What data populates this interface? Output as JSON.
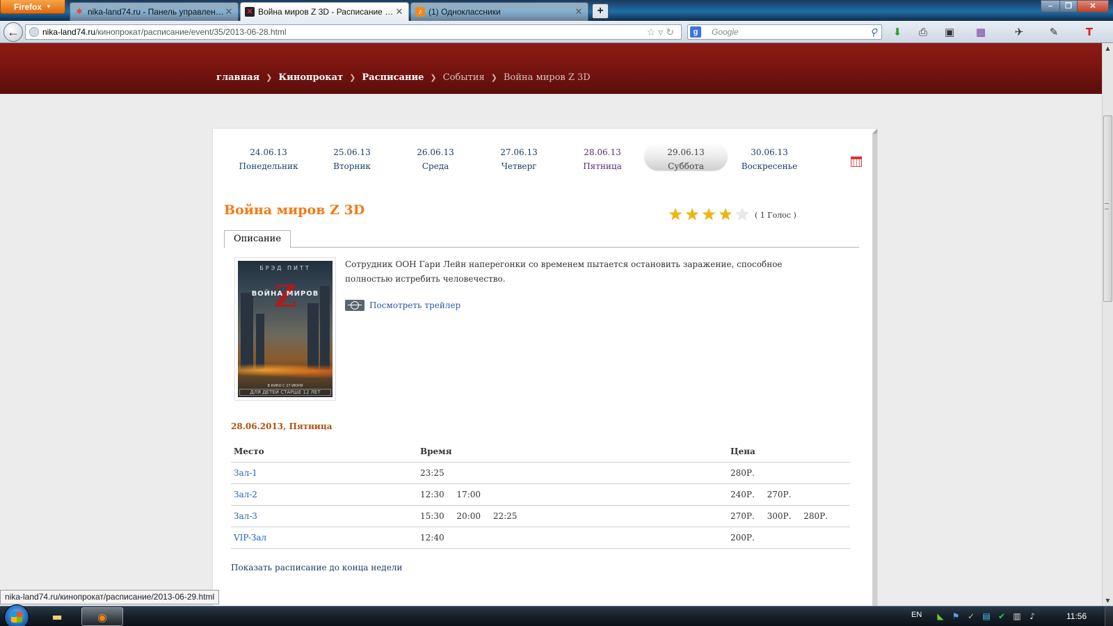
{
  "browser": {
    "app_button": "Firefox",
    "tabs": [
      {
        "label": "nika-land74.ru - Панель управления...",
        "favicon": "joomla-icon"
      },
      {
        "label": "Война миров Z 3D - Расписание - ni...",
        "favicon": "site-icon"
      },
      {
        "label": "(1) Одноклассники",
        "favicon": "odnoklassniki-icon"
      }
    ],
    "url_host": "nika-land74.ru",
    "url_path": "/кинопрокат/расписание/event/35/2013-06-28.html",
    "search_placeholder": "Google",
    "status_url": "nika-land74.ru/кинопрокат/расписание/2013-06-29.html"
  },
  "breadcrumb": [
    "главная",
    "Кинопрокат",
    "Расписание",
    "События",
    "Война миров Z 3D"
  ],
  "week": [
    {
      "date": "24.06.13",
      "day": "Понедельник"
    },
    {
      "date": "25.06.13",
      "day": "Вторник"
    },
    {
      "date": "26.06.13",
      "day": "Среда"
    },
    {
      "date": "27.06.13",
      "day": "Четверг"
    },
    {
      "date": "28.06.13",
      "day": "Пятница"
    },
    {
      "date": "29.06.13",
      "day": "Суббота"
    },
    {
      "date": "30.06.13",
      "day": "Воскресенье"
    }
  ],
  "movie": {
    "title": "Война миров Z 3D",
    "rating_stars": 4,
    "rating_max": 5,
    "votes": "( 1 Голос )",
    "tab_label": "Описание",
    "description": "Сотрудник ООН Гари Лейн наперегонки со временем пытается остановить заражение, способное полностью истребить человечество.",
    "trailer_link": "Посмотреть трейлер",
    "poster": {
      "actor": "БРЭД ПИТТ",
      "title": "ВОЙНА МИРОВ",
      "letter": "Z",
      "release": "В КИНО С 27 ИЮНЯ",
      "age": "ДЛЯ ДЕТЕЙ СТАРШЕ 12 ЛЕТ"
    }
  },
  "schedule": {
    "date_heading": "28.06.2013, Пятница",
    "headers": {
      "place": "Место",
      "time": "Время",
      "price": "Цена"
    },
    "rows": [
      {
        "hall": "Зал-1",
        "times": [
          "23:25"
        ],
        "prices": [
          "280Р."
        ]
      },
      {
        "hall": "Зал-2",
        "times": [
          "12:30",
          "17:00"
        ],
        "prices": [
          "240Р.",
          "270Р."
        ]
      },
      {
        "hall": "Зал-3",
        "times": [
          "15:30",
          "20:00",
          "22:25"
        ],
        "prices": [
          "270Р.",
          "300Р.",
          "280Р."
        ]
      },
      {
        "hall": "VIP-Зал",
        "times": [
          "12:40"
        ],
        "prices": [
          "200Р."
        ]
      }
    ],
    "show_week_link": "Показать расписание до конца недели"
  },
  "taskbar": {
    "language": "EN",
    "clock": "11:56"
  },
  "colors": {
    "header_red": "#7a1510",
    "title_orange": "#f07c17",
    "date_heading": "#b0500e",
    "link_blue": "#1d63b7"
  }
}
